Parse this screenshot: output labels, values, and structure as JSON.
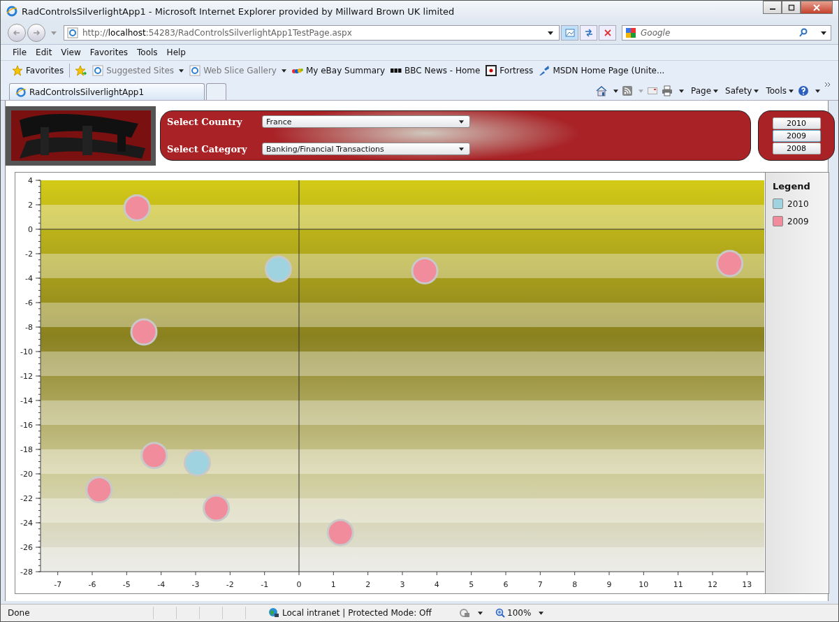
{
  "window": {
    "title": "RadControlsSilverlightApp1 - Microsoft Internet Explorer provided by Millward Brown UK limited"
  },
  "address_bar": {
    "scheme": "http://",
    "host": "localhost",
    "rest": ":54283/RadControlsSilverlightApp1TestPage.aspx"
  },
  "search": {
    "placeholder": "Google"
  },
  "menu": [
    "File",
    "Edit",
    "View",
    "Favorites",
    "Tools",
    "Help"
  ],
  "favorites_bar": {
    "label": "Favorites",
    "items": [
      {
        "label": "Suggested Sites",
        "kind": "ie",
        "dropdown": true
      },
      {
        "label": "Web Slice Gallery",
        "kind": "ie",
        "dropdown": true
      },
      {
        "label": "My eBay Summary",
        "kind": "ebay",
        "dropdown": false
      },
      {
        "label": "BBC News - Home",
        "kind": "bbc",
        "dropdown": false
      },
      {
        "label": "Fortress",
        "kind": "fortress",
        "dropdown": false
      },
      {
        "label": "MSDN Home Page (Unite...",
        "kind": "msdn",
        "dropdown": false
      }
    ]
  },
  "tabs": [
    {
      "label": "RadControlsSilverlightApp1",
      "selected": true
    }
  ],
  "command_bar": [
    "Page",
    "Safety",
    "Tools"
  ],
  "filters": [
    {
      "label": "Select Country",
      "value": "France"
    },
    {
      "label": "Select Category",
      "value": "Banking/Financial Transactions"
    }
  ],
  "years": [
    {
      "label": "2010",
      "selected": false
    },
    {
      "label": "2009",
      "selected": true
    },
    {
      "label": "2008",
      "selected": false
    }
  ],
  "chart": {
    "legend_title": "Legend",
    "chart_data": {
      "type": "scatter",
      "xlim": [
        -7.5,
        13.5
      ],
      "ylim": [
        -28,
        4
      ],
      "x": [
        -0.6,
        -2.95,
        -4.7,
        3.65,
        12.5,
        -4.5,
        -4.2,
        -5.8,
        -2.4,
        1.2
      ],
      "xticks": [
        -7,
        -6,
        -5,
        -4,
        -3,
        -2,
        -1,
        0,
        1,
        2,
        3,
        4,
        5,
        6,
        7,
        8,
        9,
        10,
        11,
        12,
        13
      ],
      "yticks": [
        4,
        2,
        0,
        -2,
        -4,
        -6,
        -8,
        -10,
        -12,
        -14,
        -16,
        -18,
        -20,
        -22,
        -24,
        -26,
        -28
      ],
      "series": [
        {
          "name": "2010",
          "color": "#9fd3e0",
          "values": [
            -3.25,
            -19.1,
            null,
            null,
            null,
            null,
            null,
            null,
            null,
            null
          ]
        },
        {
          "name": "2009",
          "color": "#f08c9c",
          "values": [
            null,
            null,
            1.75,
            -3.4,
            -2.8,
            -8.4,
            -18.5,
            -21.3,
            -22.8,
            -24.8
          ]
        }
      ]
    }
  },
  "status_bar": {
    "text": "Done",
    "zone": "Local intranet | Protected Mode: Off",
    "zoom": "100%"
  }
}
